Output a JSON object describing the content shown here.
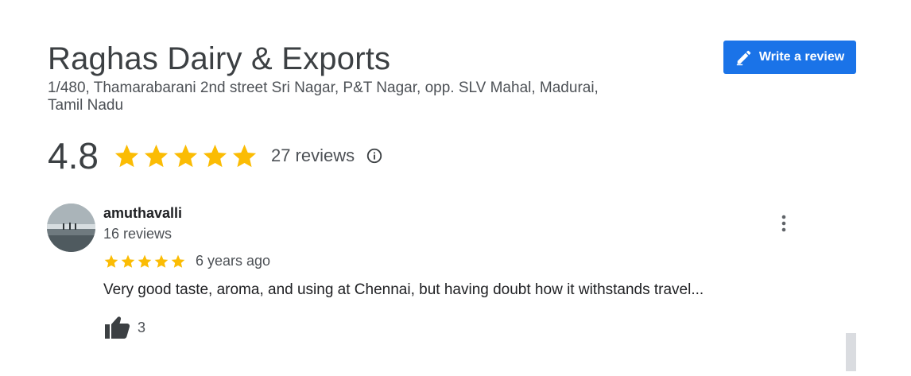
{
  "business": {
    "name": "Raghas Dairy & Exports",
    "address": "1/480, Thamarabarani 2nd street Sri Nagar, P&T Nagar, opp. SLV Mahal, Madurai, Tamil Nadu"
  },
  "actions": {
    "write_review_label": "Write a review",
    "write_review_icon": "pencil-icon"
  },
  "rating": {
    "value": "4.8",
    "stars": 5,
    "reviews_label": "27 reviews",
    "info_icon": "info-icon"
  },
  "review": {
    "author": "amuthavalli",
    "author_reviews": "16 reviews",
    "stars": 5,
    "age": "6 years ago",
    "text": "Very good taste, aroma, and using at Chennai, but having doubt how it withstands travel...",
    "likes": "3",
    "like_icon": "thumbs-up-icon",
    "menu_icon": "more-vert-icon"
  },
  "colors": {
    "accent": "#1a73e8",
    "star": "#fbbc04"
  }
}
